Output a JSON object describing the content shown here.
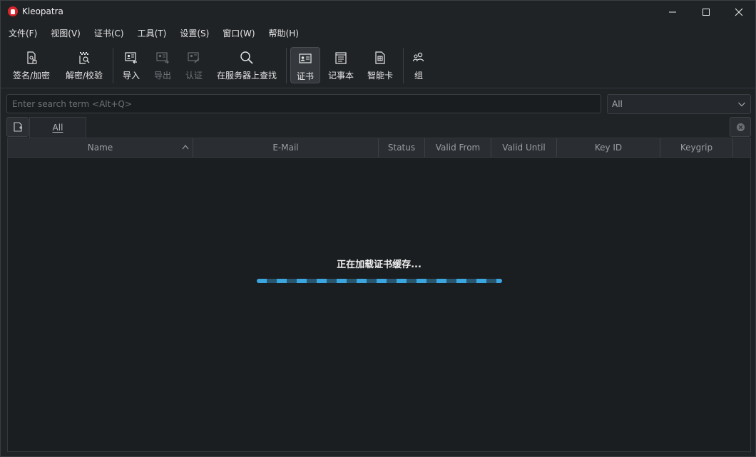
{
  "window": {
    "title": "Kleopatra"
  },
  "menu": [
    {
      "label": "文件(F)"
    },
    {
      "label": "视图(V)"
    },
    {
      "label": "证书(C)"
    },
    {
      "label": "工具(T)"
    },
    {
      "label": "设置(S)"
    },
    {
      "label": "窗口(W)"
    },
    {
      "label": "帮助(H)"
    }
  ],
  "toolbar": {
    "sign_encrypt": "签名/加密",
    "decrypt_verify": "解密/校验",
    "import": "导入",
    "export": "导出",
    "certify": "认证",
    "lookup_server": "在服务器上查找",
    "certificates": "证书",
    "notepad": "记事本",
    "smartcards": "智能卡",
    "groups": "组"
  },
  "search": {
    "placeholder": "Enter search term <Alt+Q>",
    "value": ""
  },
  "filter": {
    "selected": "All"
  },
  "tabs": [
    {
      "label": "All",
      "active": true
    }
  ],
  "table": {
    "columns": [
      "Name",
      "E-Mail",
      "Status",
      "Valid From",
      "Valid Until",
      "Key ID",
      "Keygrip"
    ],
    "sort_column": "Name",
    "sort_order": "ascending"
  },
  "loading": {
    "message": "正在加载证书缓存..."
  },
  "colors": {
    "accent": "#3aa5df",
    "background": "#1b1e22"
  }
}
